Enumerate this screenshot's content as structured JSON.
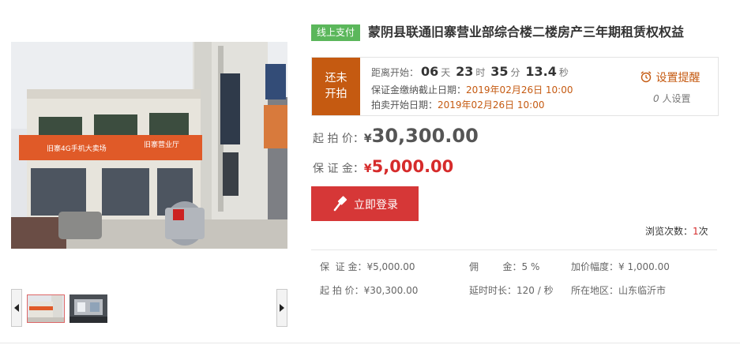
{
  "gallery": {
    "main_image_icon": "building-photo",
    "storefront_sign_1": "旧寨4G手机大卖场",
    "storefront_sign_2": "旧寨营业厅",
    "prev_icon": "triangle-left-icon",
    "next_icon": "triangle-right-icon"
  },
  "header": {
    "pay_badge": "线上支付",
    "title": "蒙阴县联通旧寨营业部综合楼二楼房产三年期租赁权权益"
  },
  "status": {
    "tag_line1": "还未",
    "tag_line2": "开拍",
    "countdown_label": "距离开始：",
    "days": "06",
    "days_unit": "天",
    "hours": "23",
    "hours_unit": "时",
    "minutes": "35",
    "minutes_unit": "分",
    "seconds": "13.4",
    "seconds_unit": "秒",
    "deposit_deadline_label": "保证金缴纳截止日期：",
    "deposit_deadline": "2019年02月26日 10:00",
    "auction_start_label": "拍卖开始日期：",
    "auction_start": "2019年02月26日 10:00",
    "remind_icon": "alarm-clock-icon",
    "remind_label": "设置提醒",
    "remind_count": "0",
    "remind_count_suffix": "人设置"
  },
  "prices": {
    "start_label": "起 拍 价：",
    "start_currency": "¥",
    "start_amount": "30,300.00",
    "deposit_label": "保 证 金：",
    "deposit_currency": "¥",
    "deposit_amount": "5,000.00"
  },
  "actions": {
    "login_icon": "gavel-icon",
    "login_label": "立即登录"
  },
  "views": {
    "label": "浏览次数：",
    "count": "1",
    "unit": "次"
  },
  "details": {
    "deposit": "保  证 金：¥5,000.00",
    "commission": "佣        金：5 %",
    "increment": "加价幅度：¥ 1,000.00",
    "start_price": "起 拍 价：¥30,300.00",
    "delay": "延时时长：120 / 秒",
    "location": "所在地区：山东临沂市"
  },
  "colors": {
    "accent_orange": "#c55a11",
    "badge_green": "#5bb75b",
    "button_red": "#d63737",
    "price_red": "#d62b2b"
  }
}
